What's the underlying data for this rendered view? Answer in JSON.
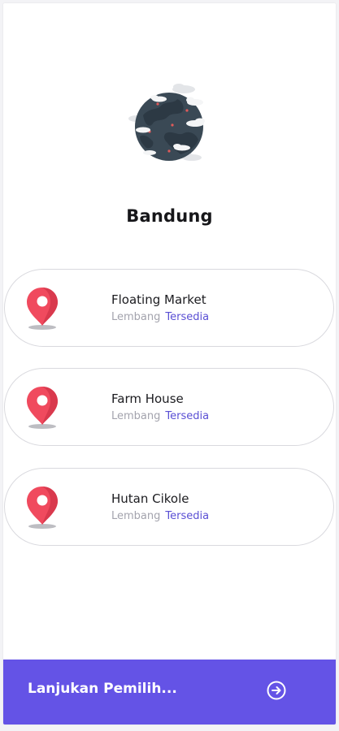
{
  "header": {
    "city": "Bandung"
  },
  "locations": [
    {
      "name": "Floating Market",
      "area": "Lembang",
      "status": "Tersedia"
    },
    {
      "name": "Farm House",
      "area": "Lembang",
      "status": "Tersedia"
    },
    {
      "name": "Hutan Cikole",
      "area": "Lembang",
      "status": "Tersedia"
    }
  ],
  "footer": {
    "cta_label": "Lanjukan Pemilih..."
  },
  "icons": {
    "hero": "globe-icon",
    "pin": "map-pin-icon",
    "cta": "arrow-right-circle-icon"
  },
  "colors": {
    "accent": "#6453e6",
    "status": "#5a4fd4",
    "pin": "#f04a5e",
    "globe": "#3a4955"
  }
}
